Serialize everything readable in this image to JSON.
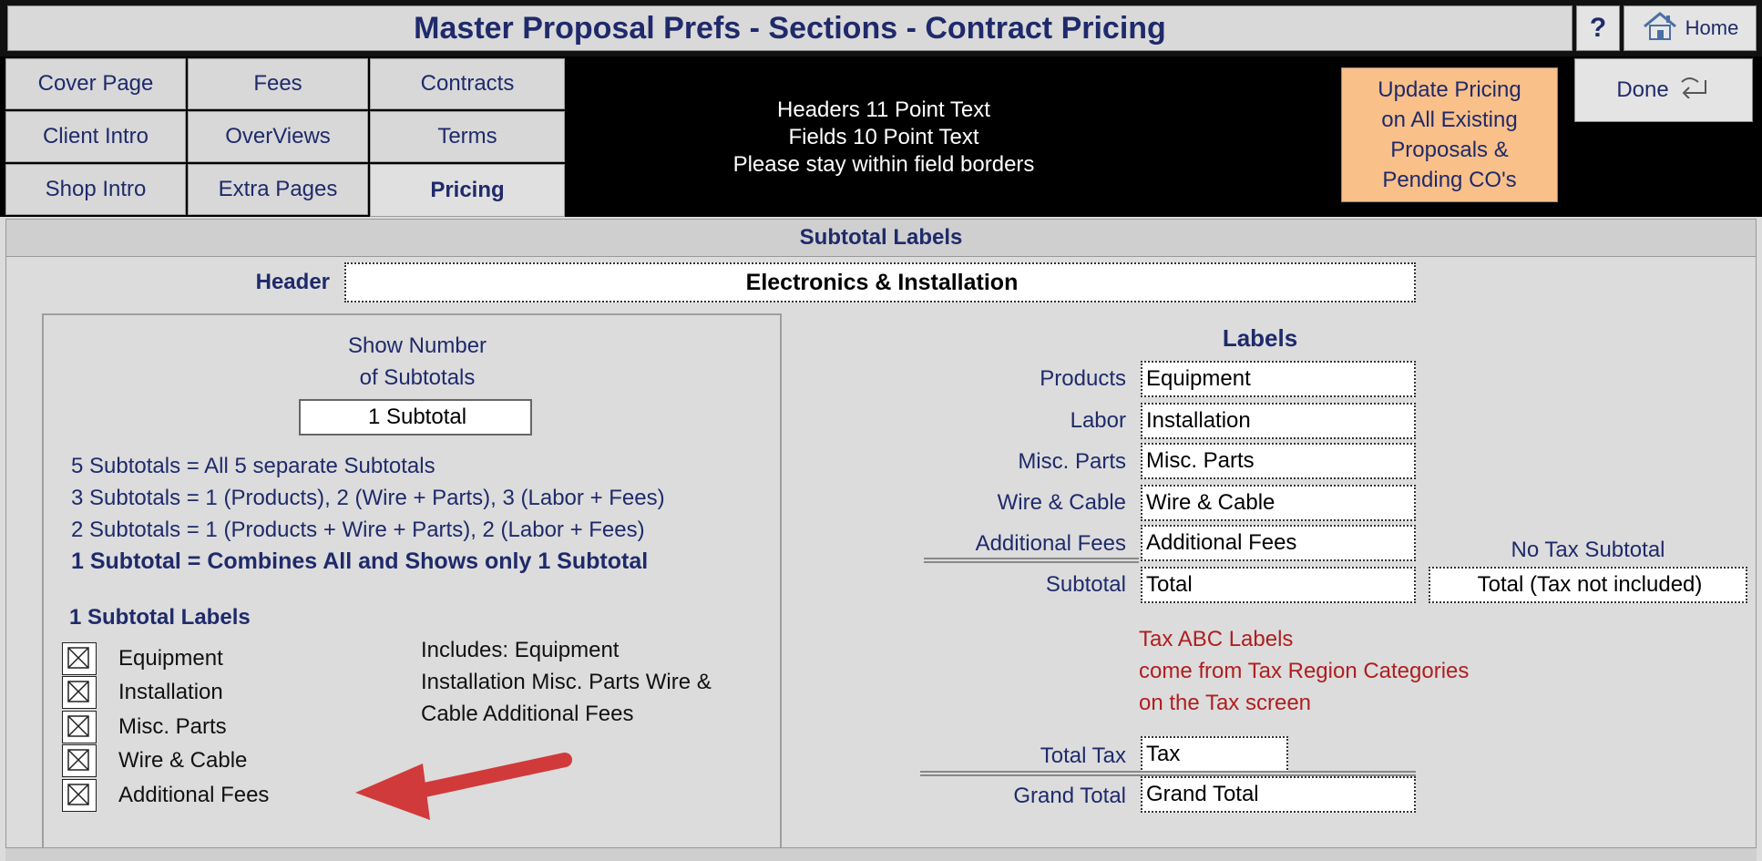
{
  "header": {
    "title": "Master Proposal Prefs - Sections - Contract Pricing",
    "help_label": "?",
    "home_label": "Home"
  },
  "tabs": [
    {
      "label": "Cover Page"
    },
    {
      "label": "Fees"
    },
    {
      "label": "Contracts"
    },
    {
      "label": "Client Intro"
    },
    {
      "label": "OverViews"
    },
    {
      "label": "Terms"
    },
    {
      "label": "Shop Intro"
    },
    {
      "label": "Extra Pages"
    },
    {
      "label": "Pricing"
    }
  ],
  "notice": {
    "line1": "Headers 11 Point Text",
    "line2": "Fields 10 Point Text",
    "line3": "Please stay within field borders"
  },
  "update_button": {
    "line1": "Update Pricing",
    "line2": "on All Existing",
    "line3": "Proposals &",
    "line4": "Pending CO's"
  },
  "done_label": "Done",
  "section_band": "Subtotal Labels",
  "header_field": {
    "label": "Header",
    "value": "Electronics & Installation"
  },
  "subtotals": {
    "show_label_1": "Show Number",
    "show_label_2": "of Subtotals",
    "selected": "1 Subtotal",
    "options": [
      "5  Subtotals = All 5 separate Subtotals",
      "3  Subtotals = 1 (Products),  2 (Wire + Parts),  3 (Labor + Fees)",
      "2  Subtotals = 1 (Products + Wire + Parts),  2 (Labor + Fees)",
      "1  Subtotal   = Combines All and Shows only 1 Subtotal"
    ],
    "labels_heading": "1 Subtotal Labels",
    "checklist": [
      "Equipment",
      "Installation",
      "Misc. Parts",
      "Wire & Cable",
      "Additional Fees"
    ],
    "includes_1": "Includes: Equipment",
    "includes_2": "Installation  Misc. Parts  Wire &",
    "includes_3": "Cable  Additional Fees"
  },
  "labels": {
    "heading": "Labels",
    "rows": [
      {
        "name": "Products",
        "value": "Equipment"
      },
      {
        "name": "Labor",
        "value": "Installation"
      },
      {
        "name": "Misc. Parts",
        "value": "Misc. Parts"
      },
      {
        "name": "Wire & Cable",
        "value": "Wire & Cable"
      },
      {
        "name": "Additional Fees",
        "value": "Additional Fees"
      }
    ],
    "subtotal_label": "Subtotal",
    "subtotal_value": "Total",
    "no_tax_heading": "No Tax Subtotal",
    "no_tax_value": "Total (Tax not included)",
    "tax_note_1": "Tax ABC Labels",
    "tax_note_2": "come from Tax Region Categories",
    "tax_note_3": "on the Tax screen",
    "total_tax_label": "Total Tax",
    "total_tax_value": "Tax",
    "grand_total_label": "Grand Total",
    "grand_total_value": "Grand Total"
  },
  "colors": {
    "accent": "#1f2a6b",
    "update_button_bg": "#f9c089",
    "note_red": "#b01e1e",
    "arrow": "#d13a3a"
  }
}
